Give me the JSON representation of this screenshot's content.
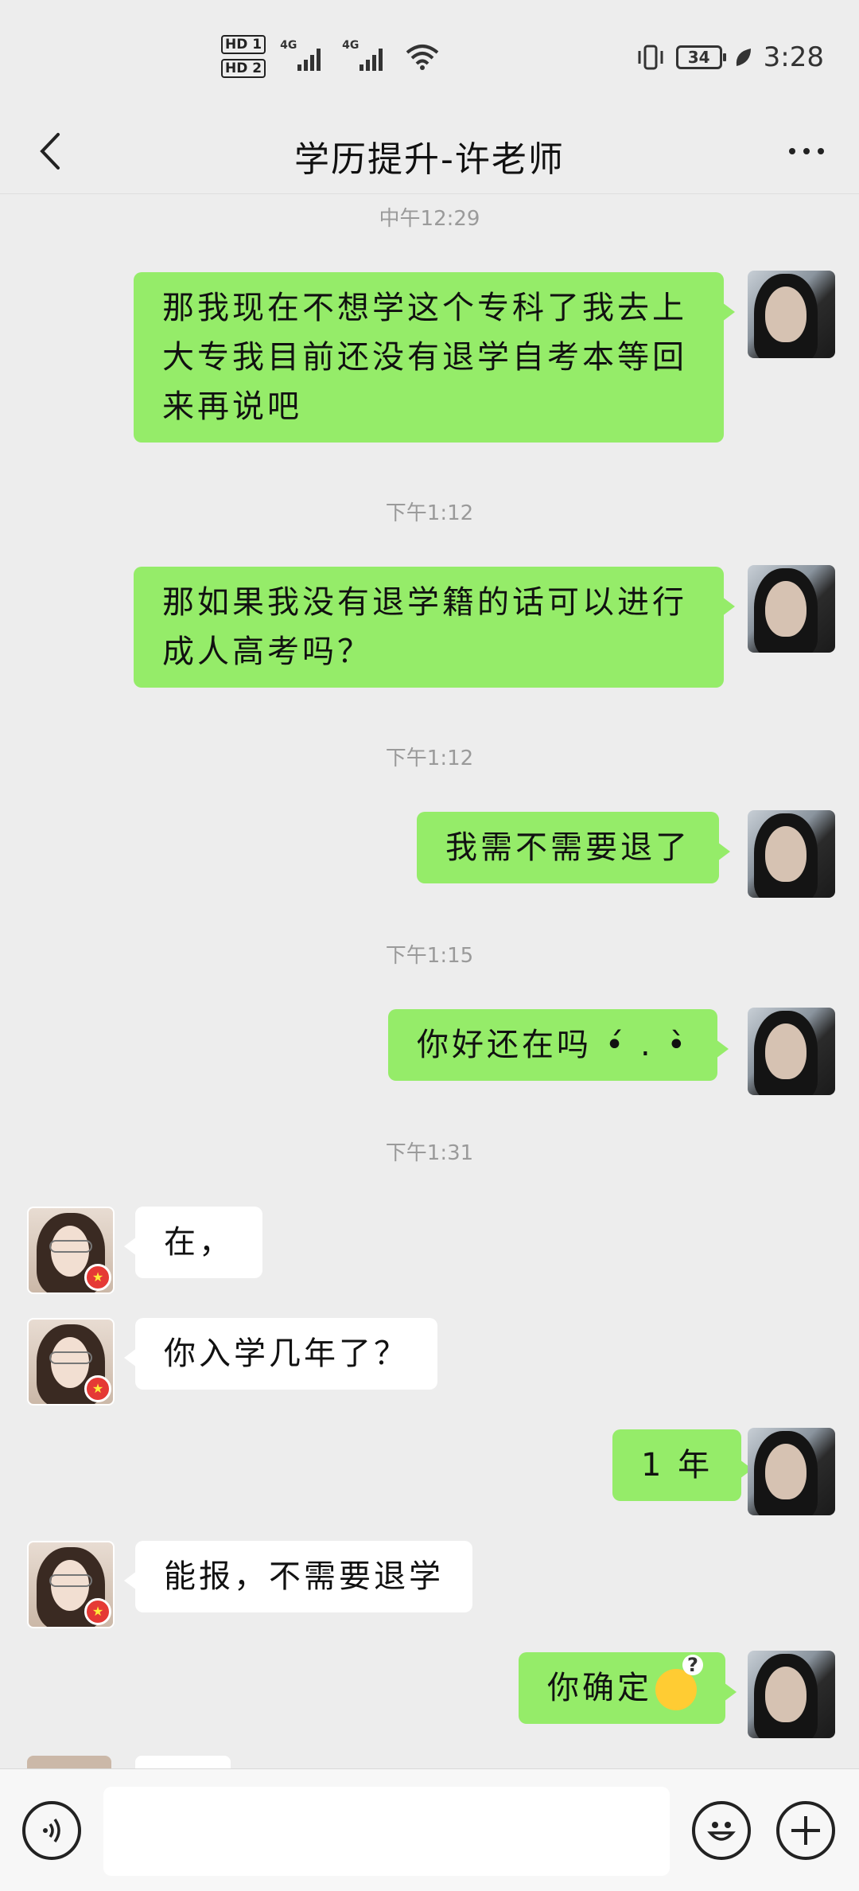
{
  "status_bar": {
    "hd1": "HD 1",
    "hd2": "HD 2",
    "net1": "4G",
    "net2": "4G",
    "battery": "34",
    "time": "3:28"
  },
  "header": {
    "title": "学历提升-许老师",
    "back_icon": "chevron-left-icon",
    "more_icon": "more-dots-icon"
  },
  "messages": [
    {
      "type": "time",
      "text": "中午12:29"
    },
    {
      "type": "msg",
      "from": "me",
      "text": "那我现在不想学这个专科了我去上大专我目前还没有退学自考本等回来再说吧"
    },
    {
      "type": "time",
      "text": "下午1:12"
    },
    {
      "type": "msg",
      "from": "me",
      "text": "那如果我没有退学籍的话可以进行成人高考吗？"
    },
    {
      "type": "time",
      "text": "下午1:12"
    },
    {
      "type": "msg",
      "from": "me",
      "text": "我需不需要退了"
    },
    {
      "type": "time",
      "text": "下午1:15"
    },
    {
      "type": "msg",
      "from": "me",
      "text": "你好还在吗 •́ . •̀"
    },
    {
      "type": "time",
      "text": "下午1:31"
    },
    {
      "type": "msg",
      "from": "them",
      "text": "在，"
    },
    {
      "type": "msg",
      "from": "them",
      "text": "你入学几年了？"
    },
    {
      "type": "msg",
      "from": "me",
      "text": "1 年"
    },
    {
      "type": "msg",
      "from": "them",
      "text": "能报，不需要退学"
    },
    {
      "type": "msg",
      "from": "me",
      "text": "你确定",
      "emoji": "confused-emoji"
    }
  ],
  "input_bar": {
    "voice_icon": "voice-icon",
    "emoji_icon": "smile-icon",
    "plus_icon": "plus-icon",
    "placeholder": ""
  },
  "colors": {
    "my_bubble": "#95ec69",
    "their_bubble": "#ffffff",
    "background": "#ededed"
  }
}
